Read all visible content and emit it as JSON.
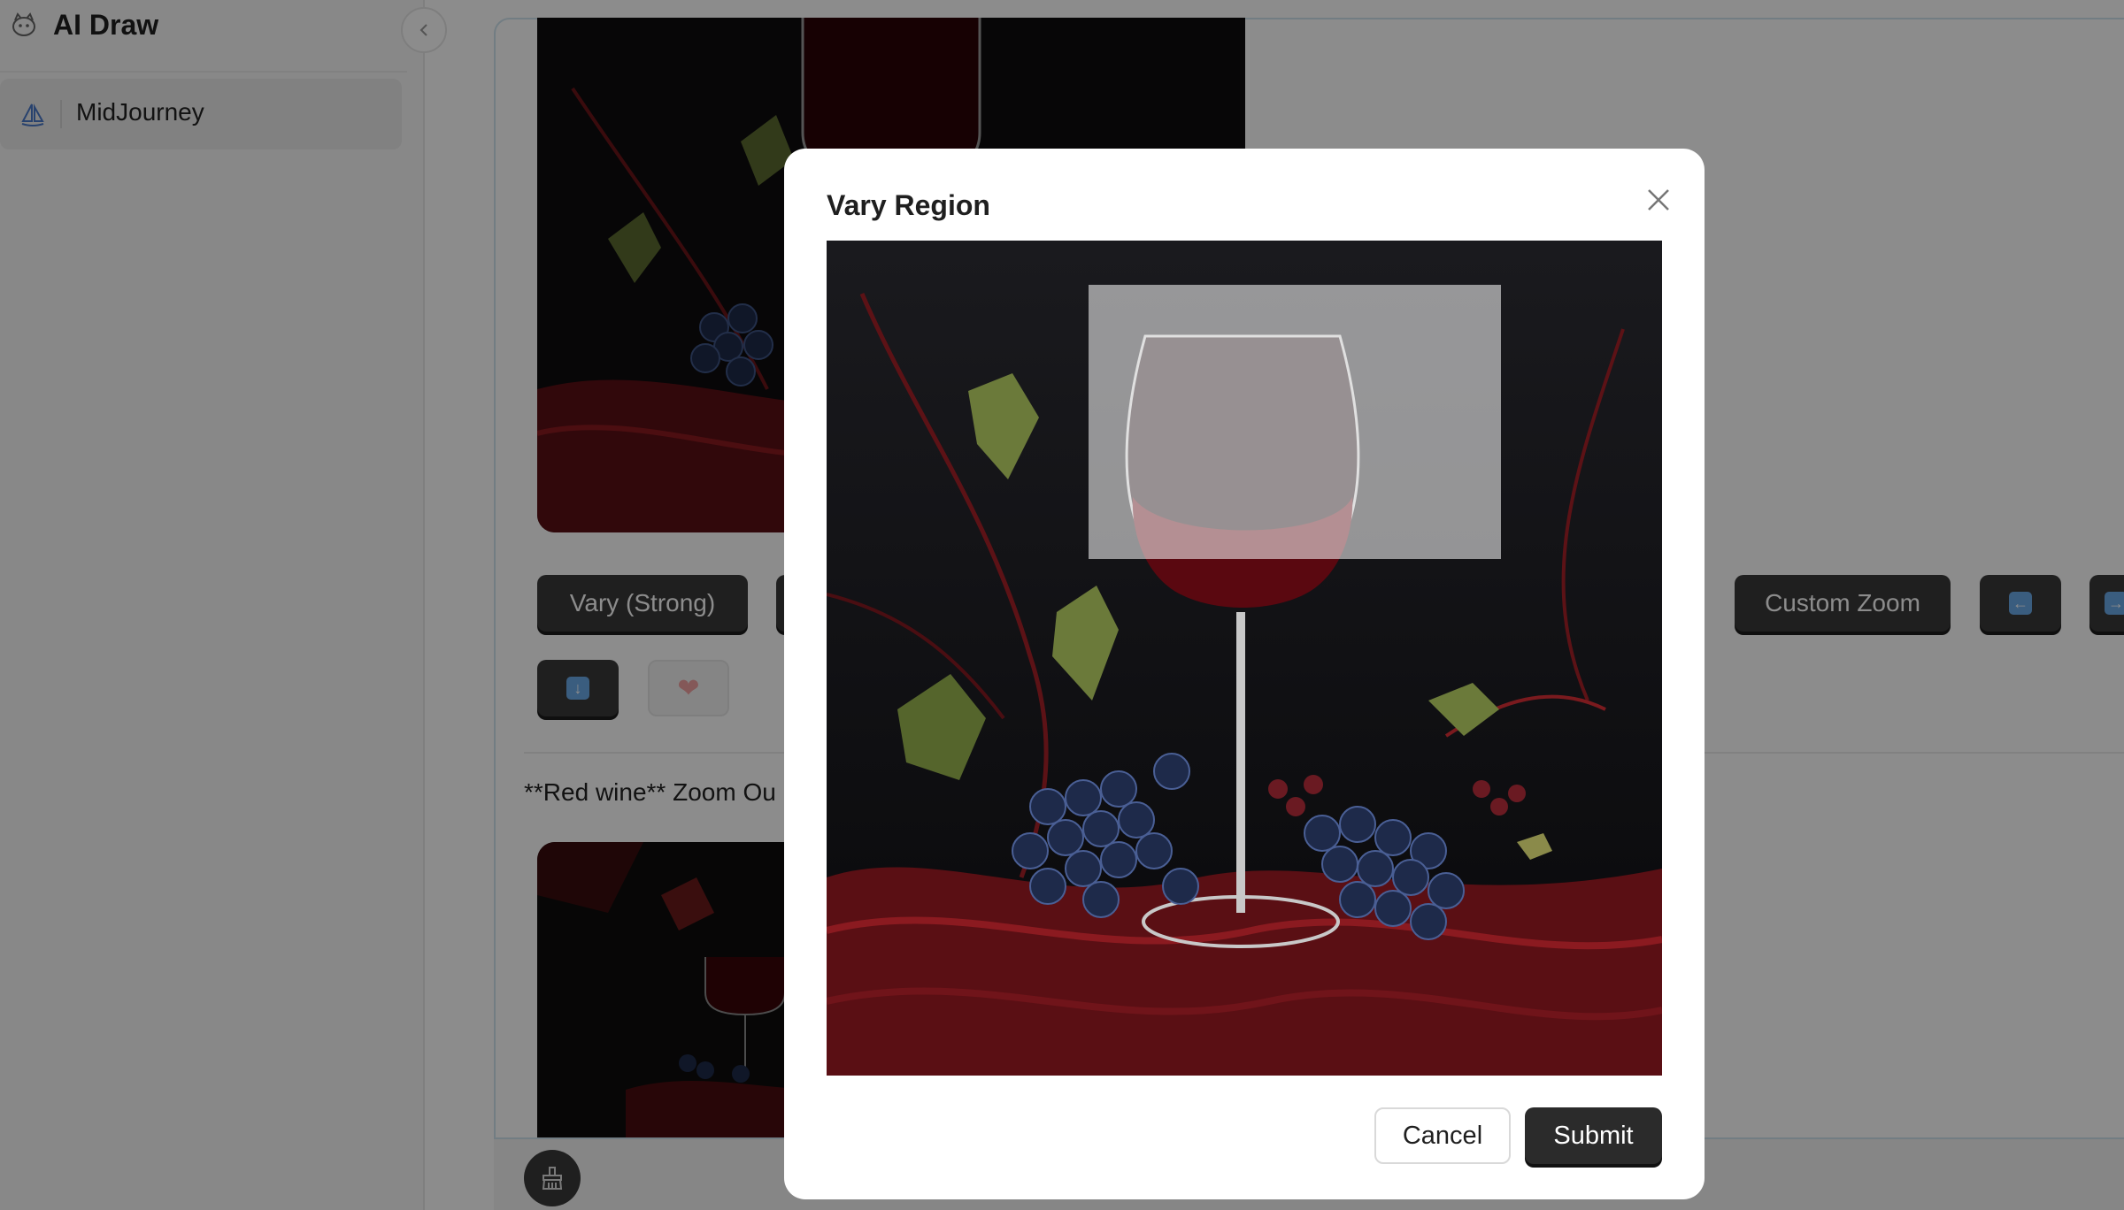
{
  "app": {
    "title": "AI Draw"
  },
  "sidebar": {
    "items": [
      {
        "label": "MidJourney",
        "icon": "sailboat-icon"
      }
    ]
  },
  "main": {
    "actions": {
      "vary_strong": "Vary (Strong)",
      "custom_zoom": "Custom Zoom"
    },
    "prompt_preview": "**Red wine** Zoom Ou"
  },
  "modal": {
    "title": "Vary Region",
    "cancel_label": "Cancel",
    "submit_label": "Submit"
  },
  "colors": {
    "primary_button": "#3a3a3a",
    "overlay": "rgba(0,0,0,0.45)",
    "panel_border": "#cfe3ee",
    "selection": "rgba(255,255,255,0.55)"
  }
}
